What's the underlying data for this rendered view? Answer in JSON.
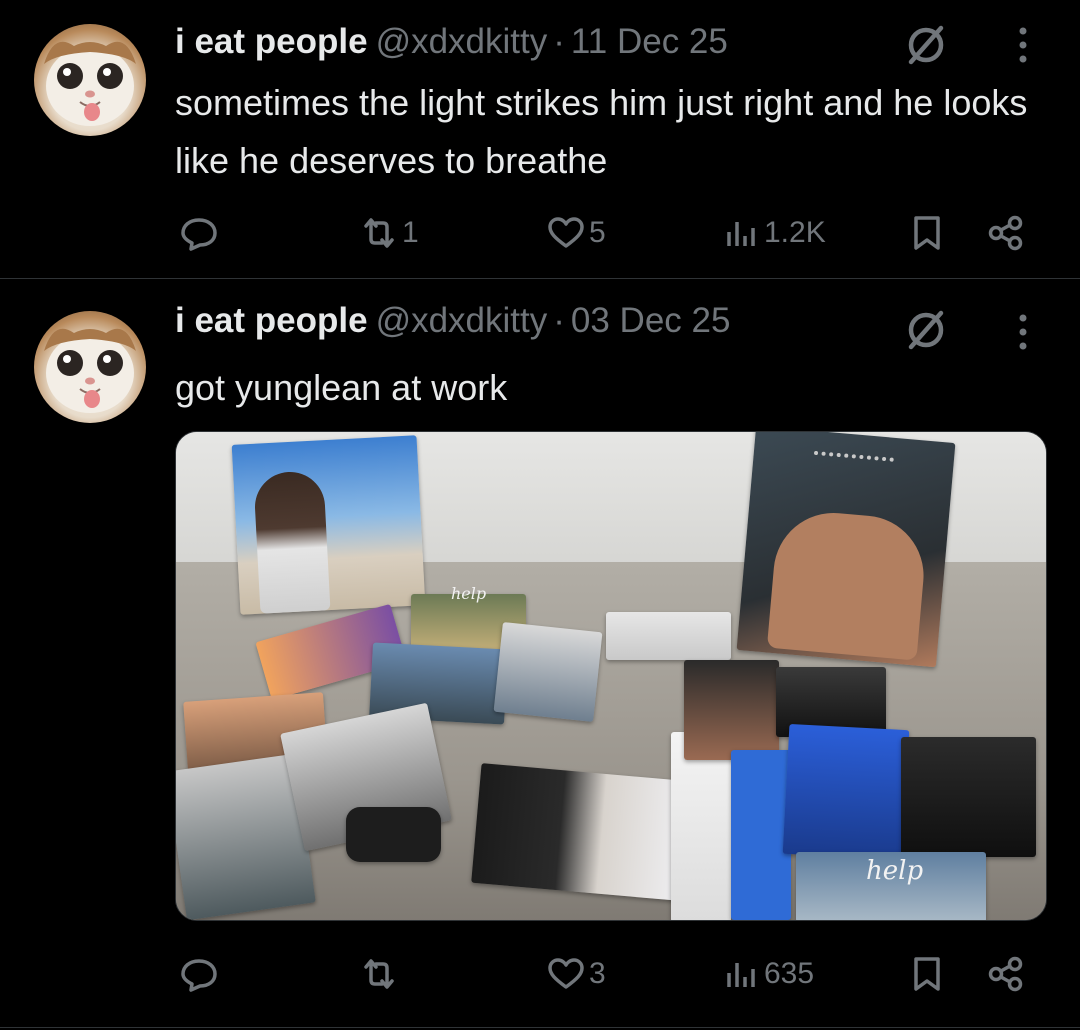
{
  "tweets": [
    {
      "display_name": "i eat people",
      "handle": "@xdxdkitty",
      "separator": "·",
      "date": "11 Dec 25",
      "text": "sometimes the light strikes him just right and he looks like he deserves to breathe",
      "reply_count": "",
      "retweet_count": "1",
      "like_count": "5",
      "views_count": "1.2K"
    },
    {
      "display_name": "i eat people",
      "handle": "@xdxdkitty",
      "separator": "·",
      "date": "03 Dec 25",
      "text": "got yunglean at work",
      "reply_count": "",
      "retweet_count": "",
      "like_count": "3",
      "views_count": "635",
      "media_label": "help"
    }
  ],
  "icons": {
    "avatar": "cat-avatar",
    "muted": "muted-circle-slash-icon",
    "more": "more-vertical-icon",
    "reply": "reply-bubble-icon",
    "retweet": "retweet-icon",
    "like": "heart-icon",
    "views": "views-bars-icon",
    "bookmark": "bookmark-icon",
    "share": "share-icon"
  },
  "colors": {
    "background": "#000000",
    "primary_text": "#e7e9ea",
    "secondary_text": "#71767b",
    "divider": "#2f3336"
  }
}
